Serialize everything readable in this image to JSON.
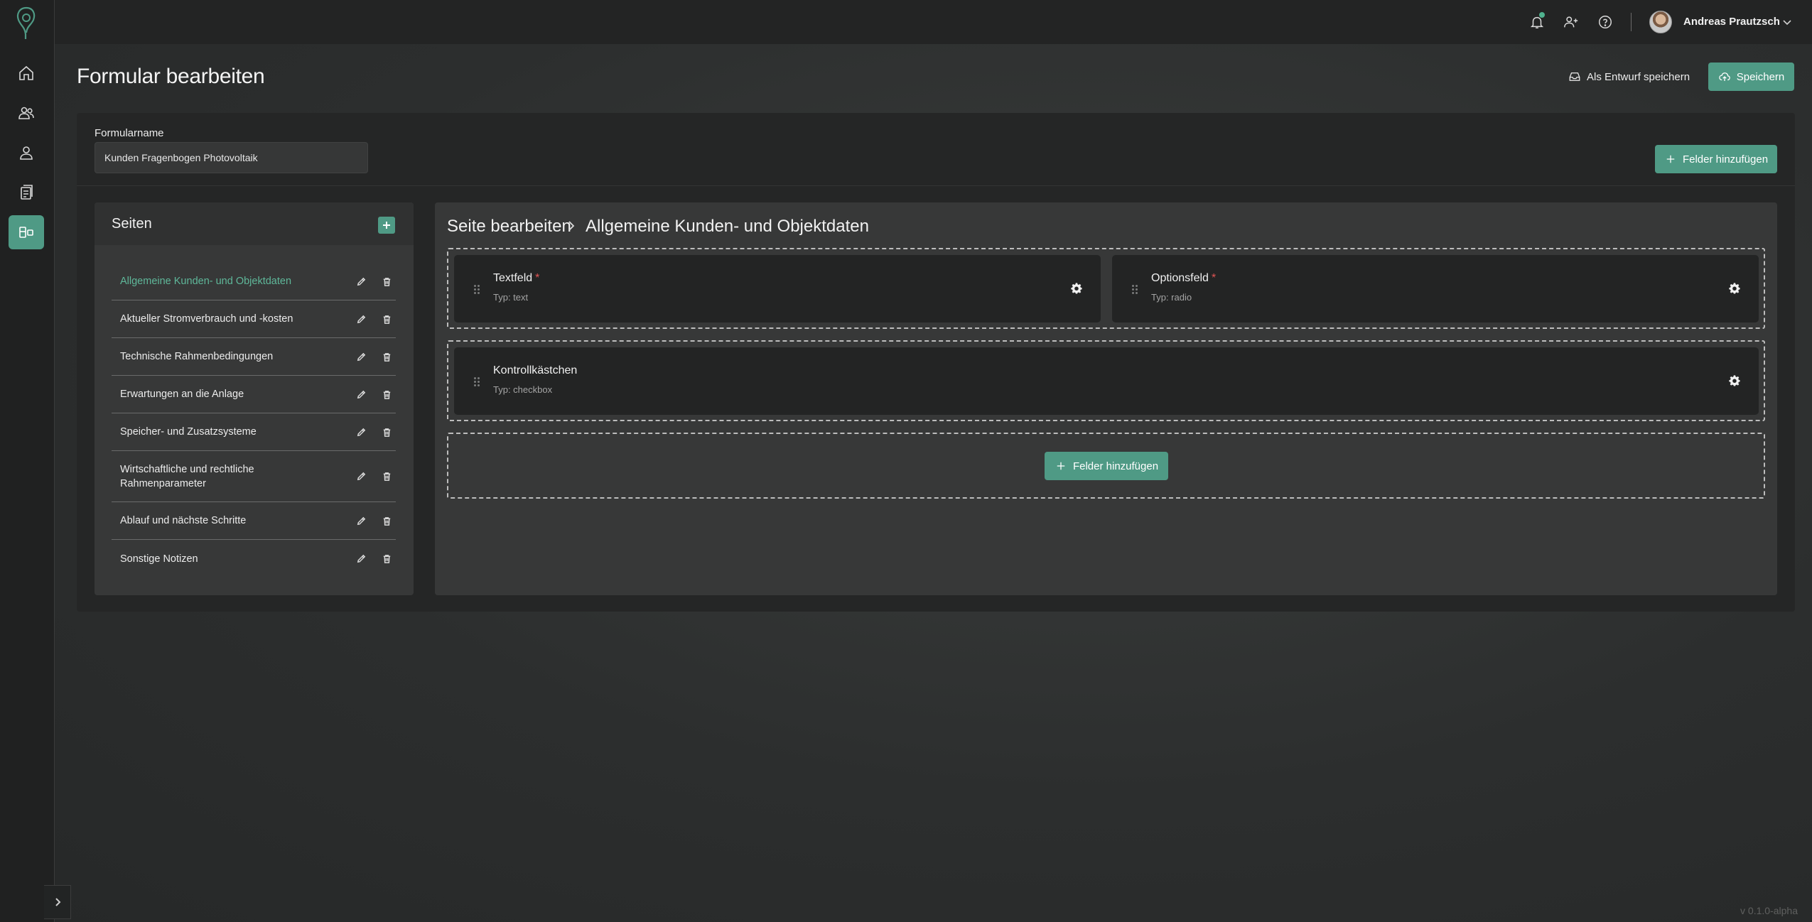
{
  "topbar": {
    "user_name": "Andreas Prautzsch",
    "icons": [
      "bell-icon",
      "add-user-icon",
      "help-icon",
      "chevron-down-icon"
    ]
  },
  "sidebar": {
    "items": [
      {
        "name": "home",
        "icon": "home-icon"
      },
      {
        "name": "contacts",
        "icon": "users-icon"
      },
      {
        "name": "profile",
        "icon": "user-icon"
      },
      {
        "name": "documents",
        "icon": "documents-icon"
      },
      {
        "name": "forms",
        "icon": "form-builder-icon",
        "active": true
      }
    ]
  },
  "header": {
    "title": "Formular bearbeiten",
    "draft_label": "Als Entwurf speichern",
    "save_label": "Speichern"
  },
  "form": {
    "name_label": "Formularname",
    "name_value": "Kunden Fragenbogen Photovoltaik",
    "add_fields_label": "Felder hinzufügen"
  },
  "pages": {
    "title": "Seiten",
    "items": [
      {
        "label": "Allgemeine Kunden- und Objektdaten",
        "active": true
      },
      {
        "label": "Aktueller Stromverbrauch und -kosten"
      },
      {
        "label": "Technische Rahmenbedingungen"
      },
      {
        "label": "Erwartungen an die Anlage"
      },
      {
        "label": "Speicher- und Zusatzsysteme"
      },
      {
        "label": "Wirtschaftliche und rechtliche Rahmenparameter"
      },
      {
        "label": "Ablauf und nächste Schritte"
      },
      {
        "label": "Sonstige Notizen"
      }
    ]
  },
  "editor": {
    "breadcrumb_root": "Seite bearbeiten",
    "breadcrumb_page": "Allgemeine Kunden- und Objektdaten",
    "fields": [
      {
        "name": "Textfeld",
        "type": "Typ: text",
        "required": true
      },
      {
        "name": "Optionsfeld",
        "type": "Typ: radio",
        "required": true
      },
      {
        "name": "Kontrollkästchen",
        "type": "Typ: checkbox",
        "required": false
      }
    ],
    "add_fields_label": "Felder hinzufügen"
  },
  "version": "v 0.1.0-alpha",
  "colors": {
    "accent": "#4f9a85",
    "accent_text": "#5fb89a",
    "required": "#e05454",
    "surface": "#252626"
  }
}
